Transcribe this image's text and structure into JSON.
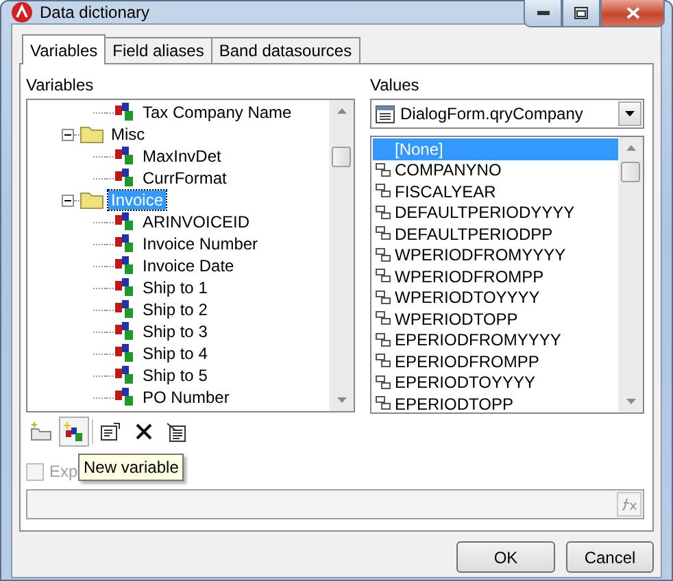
{
  "window": {
    "title": "Data dictionary"
  },
  "tabs": [
    {
      "label": "Variables",
      "selected": true
    },
    {
      "label": "Field aliases",
      "selected": false
    },
    {
      "label": "Band datasources",
      "selected": false
    }
  ],
  "variables": {
    "label": "Variables",
    "tree": [
      {
        "kind": "hidden",
        "children": [
          {
            "kind": "variable",
            "label": "Tax Company Name",
            "selected": false
          }
        ]
      },
      {
        "kind": "folder",
        "label": "Misc",
        "expanded": true,
        "selected": false,
        "children": [
          {
            "kind": "variable",
            "label": "MaxInvDet",
            "selected": false
          },
          {
            "kind": "variable",
            "label": "CurrFormat",
            "selected": false
          }
        ]
      },
      {
        "kind": "folder",
        "label": "Invoice",
        "expanded": true,
        "selected": true,
        "children": [
          {
            "kind": "variable",
            "label": "ARINVOICEID",
            "selected": false
          },
          {
            "kind": "variable",
            "label": "Invoice Number",
            "selected": false
          },
          {
            "kind": "variable",
            "label": "Invoice Date",
            "selected": false
          },
          {
            "kind": "variable",
            "label": "Ship to 1",
            "selected": false
          },
          {
            "kind": "variable",
            "label": "Ship to 2",
            "selected": false
          },
          {
            "kind": "variable",
            "label": "Ship to 3",
            "selected": false
          },
          {
            "kind": "variable",
            "label": "Ship to 4",
            "selected": false
          },
          {
            "kind": "variable",
            "label": "Ship to 5",
            "selected": false
          },
          {
            "kind": "variable",
            "label": "PO Number",
            "selected": false
          }
        ]
      }
    ]
  },
  "values": {
    "label": "Values",
    "source": "DialogForm.qryCompany",
    "items": [
      {
        "kind": "none",
        "label": "[None]",
        "selected": true
      },
      {
        "kind": "field",
        "label": "COMPANYNO",
        "selected": false
      },
      {
        "kind": "field",
        "label": "FISCALYEAR",
        "selected": false
      },
      {
        "kind": "field",
        "label": "DEFAULTPERIODYYYY",
        "selected": false
      },
      {
        "kind": "field",
        "label": "DEFAULTPERIODPP",
        "selected": false
      },
      {
        "kind": "field",
        "label": "WPERIODFROMYYYY",
        "selected": false
      },
      {
        "kind": "field",
        "label": "WPERIODFROMPP",
        "selected": false
      },
      {
        "kind": "field",
        "label": "WPERIODTOYYYY",
        "selected": false
      },
      {
        "kind": "field",
        "label": "WPERIODTOPP",
        "selected": false
      },
      {
        "kind": "field",
        "label": "EPERIODFROMYYYY",
        "selected": false
      },
      {
        "kind": "field",
        "label": "EPERIODFROMPP",
        "selected": false
      },
      {
        "kind": "field",
        "label": "EPERIODTOYYYY",
        "selected": false
      },
      {
        "kind": "field",
        "label": "EPERIODTOPP",
        "selected": false
      }
    ]
  },
  "toolbar": [
    {
      "kind": "new-folder",
      "hovered": false
    },
    {
      "kind": "new-variable",
      "hovered": true
    },
    {
      "kind": "properties",
      "hovered": false
    },
    {
      "kind": "delete",
      "hovered": false
    },
    {
      "kind": "edit-list",
      "hovered": false
    }
  ],
  "tooltip": "New variable",
  "expression_checkbox": {
    "label": "Exp",
    "checked": false,
    "disabled": true
  },
  "buttons": [
    {
      "label": "OK"
    },
    {
      "label": "Cancel"
    }
  ]
}
